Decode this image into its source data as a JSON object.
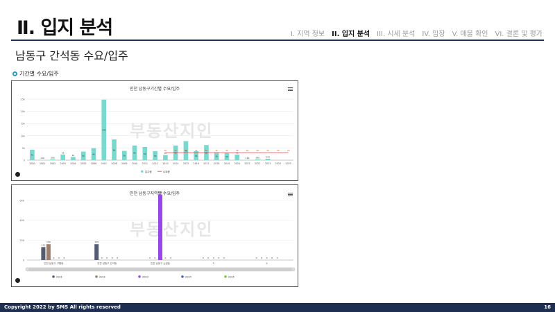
{
  "header": {
    "title": "Ⅱ. 입지 분석",
    "nav": [
      "I. 지역 정보",
      "II. 입지 분석",
      "III. 시세 분석",
      "IV. 임장",
      "V. 매물 확인",
      "VI. 결론 및 평가"
    ],
    "active_nav": 1
  },
  "subtitle": "남동구 간석동 수요/입주",
  "section_label": "기간별 수요/입주",
  "watermark": "부동산지인",
  "footer": {
    "copyright": "Copyright 2022 by SMS All rights reserved",
    "page": "16"
  },
  "colors": {
    "accent_navy": "#1f2f52",
    "supply_teal": "#7ad9cf",
    "demand_red": "#e0453a",
    "y2021": "#555b70",
    "y2022": "#9b7e6c",
    "y2023": "#9747e8",
    "y2024": "#3a64c9",
    "y2025": "#6fcf2f"
  },
  "chart_data": [
    {
      "type": "bar",
      "title": "인천 남동구기간별 수요/입주",
      "categories": [
        "2000",
        "2001",
        "2002",
        "2003",
        "2004",
        "2005",
        "2006",
        "2007",
        "2008",
        "2009",
        "2010",
        "2011",
        "2012",
        "2013",
        "2014",
        "2015",
        "2016",
        "2017",
        "2018",
        "2019",
        "2020",
        "2021",
        "2022",
        "2023",
        "2024",
        "2025"
      ],
      "ylim": [
        0,
        25000
      ],
      "yticks": [
        0,
        5000,
        10000,
        15000,
        20000,
        25000
      ],
      "ytick_labels": [
        "0",
        "5k",
        "10k",
        "15k",
        "20k",
        "25k"
      ],
      "series": [
        {
          "name": "입주량",
          "kind": "bar",
          "values": [
            4300,
            110,
            300,
            2300,
            1300,
            3500,
            4900,
            24800,
            8500,
            3800,
            6000,
            5400,
            3700,
            2100,
            6000,
            7800,
            3700,
            6200,
            3200,
            2900,
            2300,
            130,
            290,
            570,
            0,
            0
          ],
          "labels": [
            "4k",
            "110",
            "300",
            "2k",
            "1k",
            "3k",
            "4k",
            "24k",
            "8k",
            "3k",
            "6k",
            "5k",
            "3k",
            "2k",
            "6k",
            "7k",
            "3k",
            "6k",
            "3k",
            "2k",
            "2k",
            "130",
            "290",
            "570",
            "",
            ""
          ]
        },
        {
          "name": "수요량",
          "kind": "line",
          "start_index": 13,
          "values": [
            3100,
            3100,
            3100,
            3100,
            3100,
            3100,
            3100,
            3100,
            3100,
            3100,
            3100,
            3100,
            3100
          ],
          "labels": [
            "3k",
            "3k",
            "3k",
            "3k",
            "3k",
            "3k",
            "3k",
            "3k",
            "3k",
            "3k",
            "3k",
            "3k",
            "3k"
          ]
        }
      ],
      "legend_position": "bottom"
    },
    {
      "type": "bar",
      "title": "인천 남동구지역별 수요/입주",
      "categories": [
        "인천 남동구 구월동",
        "인천 남동구 간석동",
        "인천 남동구 논현동",
        "",
        ""
      ],
      "ylim": [
        0,
        600
      ],
      "yticks": [
        0,
        200,
        400,
        600
      ],
      "series": [
        {
          "name": "2021",
          "values": [
            130,
            159,
            0,
            0,
            0
          ]
        },
        {
          "name": "2022",
          "values": [
            159,
            0,
            0,
            0,
            0
          ]
        },
        {
          "name": "2023",
          "values": [
            0,
            0,
            658,
            0,
            0
          ]
        },
        {
          "name": "2024",
          "values": [
            0,
            0,
            0,
            0,
            0
          ]
        },
        {
          "name": "2025",
          "values": [
            0,
            0,
            0,
            0,
            0
          ]
        }
      ],
      "extra_labels": [
        "2",
        "4"
      ],
      "legend_position": "bottom"
    }
  ]
}
